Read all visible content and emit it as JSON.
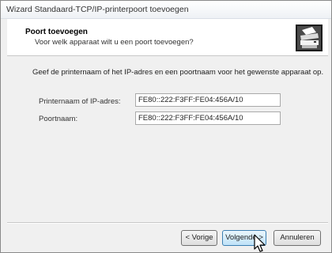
{
  "window": {
    "title": "Wizard Standaard-TCP/IP-printerpoort toevoegen"
  },
  "header": {
    "title": "Poort toevoegen",
    "subtitle": "Voor welk apparaat wilt u een poort toevoegen?",
    "icon": "printer-icon"
  },
  "body": {
    "instruction": "Geef de printernaam of het IP-adres en een poortnaam voor het gewenste apparaat op.",
    "fields": [
      {
        "label": "Printernaam of IP-adres:",
        "value": "FE80::222:F3FF:FE04:456A/10"
      },
      {
        "label": "Poortnaam:",
        "value": "FE80::222:F3FF:FE04:456A/10"
      }
    ]
  },
  "buttons": {
    "back": "< Vorige",
    "next": "Volgende >",
    "cancel": "Annuleren"
  },
  "cursor": "pointer-arrow-icon"
}
